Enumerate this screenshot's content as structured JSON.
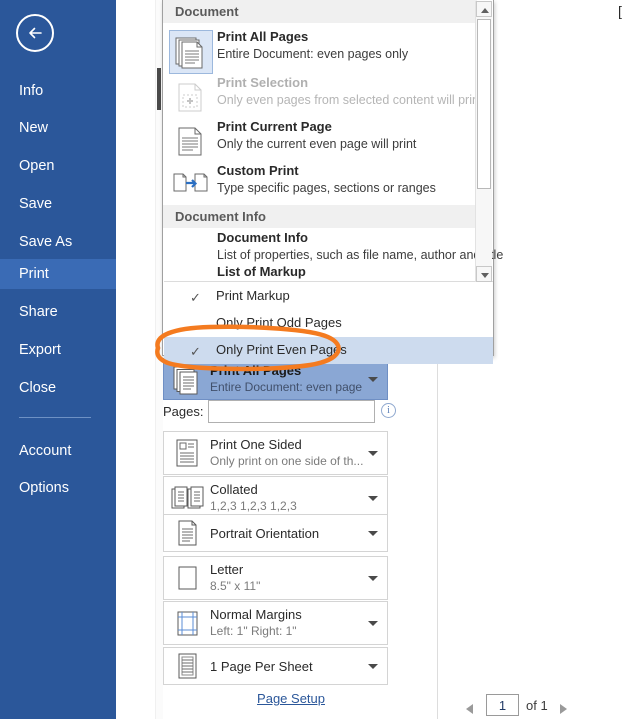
{
  "sidebar": {
    "back_icon": "back-arrow-icon",
    "items": [
      {
        "label": "Info",
        "active": false
      },
      {
        "label": "New",
        "active": false
      },
      {
        "label": "Open",
        "active": false
      },
      {
        "label": "Save",
        "active": false
      },
      {
        "label": "Save As",
        "active": false
      },
      {
        "label": "Print",
        "active": true
      },
      {
        "label": "Share",
        "active": false
      },
      {
        "label": "Export",
        "active": false
      },
      {
        "label": "Close",
        "active": false
      },
      {
        "label": "Account",
        "active": false
      },
      {
        "label": "Options",
        "active": false
      }
    ],
    "accent_active": "#3a6bb5",
    "background": "#2b579a"
  },
  "dropdown": {
    "sections": [
      {
        "header": "Document",
        "items": [
          {
            "title": "Print All Pages",
            "subtitle": "Entire Document: even pages only",
            "icon": "print-all-pages-icon",
            "disabled": false,
            "icon_selected": true
          },
          {
            "title": "Print Selection",
            "subtitle": "Only even pages from selected content will print",
            "icon": "print-selection-icon",
            "disabled": true,
            "icon_selected": false
          },
          {
            "title": "Print Current Page",
            "subtitle": "Only the current even page will print",
            "icon": "print-current-page-icon",
            "disabled": false,
            "icon_selected": false
          },
          {
            "title": "Custom Print",
            "subtitle": "Type specific pages, sections or ranges",
            "icon": "custom-print-icon",
            "disabled": false,
            "icon_selected": false
          }
        ]
      },
      {
        "header": "Document Info",
        "items": [
          {
            "title": "Document Info",
            "subtitle": "List of properties, such as file name, author and title",
            "icon": "document-info-icon",
            "disabled": false,
            "icon_selected": false
          },
          {
            "title": "List of Markup",
            "subtitle": "",
            "icon": "list-of-markup-icon",
            "disabled": false,
            "icon_selected": false
          }
        ]
      }
    ],
    "check_items": [
      {
        "label": "Print Markup",
        "checked": true,
        "highlighted": false
      },
      {
        "label": "Only Print Odd Pages",
        "checked": false,
        "highlighted": false
      },
      {
        "label": "Only Print Even Pages",
        "checked": true,
        "highlighted": true
      }
    ],
    "check_glyph": "✓",
    "scrollbar": {
      "up_icon": "scroll-up-arrow-icon",
      "down_icon": "scroll-down-arrow-icon"
    }
  },
  "settings": {
    "rows": [
      {
        "title": "Print All Pages",
        "subtitle": "Entire Document: even page...",
        "icon": "print-all-pages-icon",
        "selected": true
      },
      {
        "title": "Print One Sided",
        "subtitle": "Only print on one side of th...",
        "icon": "one-sided-icon",
        "selected": false
      },
      {
        "title": "Collated",
        "subtitle": "1,2,3   1,2,3   1,2,3",
        "icon": "collated-icon",
        "selected": false
      },
      {
        "title": "Portrait Orientation",
        "subtitle": "",
        "icon": "portrait-orientation-icon",
        "selected": false
      },
      {
        "title": "Letter",
        "subtitle": "8.5\" x 11\"",
        "icon": "paper-size-icon",
        "selected": false
      },
      {
        "title": "Normal Margins",
        "subtitle": "Left:  1\"   Right:  1\"",
        "icon": "margins-icon",
        "selected": false
      },
      {
        "title": "1 Page Per Sheet",
        "subtitle": "",
        "icon": "pages-per-sheet-icon",
        "selected": false
      }
    ],
    "pages": {
      "label": "Pages:",
      "value": "",
      "placeholder": "",
      "info_icon": "info-circle-icon",
      "info_glyph": "i"
    },
    "page_setup_link": "Page Setup"
  },
  "preview": {
    "nav": {
      "prev_icon": "previous-page-arrow-icon",
      "next_icon": "next-page-arrow-icon",
      "current_page": "1",
      "of_text": "of 1"
    },
    "corner_mark": "["
  },
  "annotation": {
    "shape": "orange-ellipse-highlight",
    "color": "#F47B20",
    "targets": "Only Print Even Pages"
  }
}
